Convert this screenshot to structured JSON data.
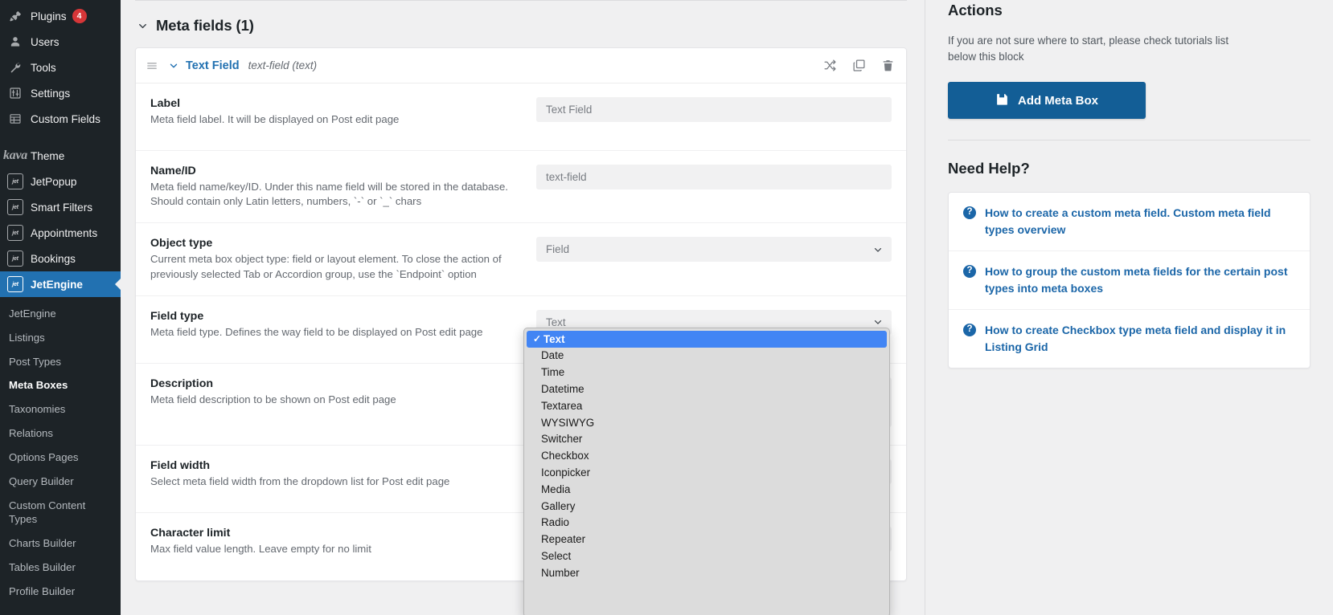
{
  "sidebar": {
    "top_items": [
      {
        "label": "Plugins",
        "icon": "plug-icon",
        "badge": "4",
        "active": false
      },
      {
        "label": "Users",
        "icon": "user-icon",
        "badge": "",
        "active": false
      },
      {
        "label": "Tools",
        "icon": "wrench-icon",
        "badge": "",
        "active": false
      },
      {
        "label": "Settings",
        "icon": "sliders-icon",
        "badge": "",
        "active": false
      },
      {
        "label": "Custom Fields",
        "icon": "table-icon",
        "badge": "",
        "active": false
      }
    ],
    "theme_item": {
      "label": "Theme",
      "logo_text": "kava"
    },
    "jet_items": [
      {
        "label": "JetPopup",
        "icon": "jet-icon",
        "active": false
      },
      {
        "label": "Smart Filters",
        "icon": "jet-icon",
        "active": false
      },
      {
        "label": "Appointments",
        "icon": "jet-icon",
        "active": false
      },
      {
        "label": "Bookings",
        "icon": "jet-icon",
        "active": false
      },
      {
        "label": "JetEngine",
        "icon": "jet-icon",
        "active": true
      }
    ],
    "submenu": [
      {
        "label": "JetEngine",
        "current": false
      },
      {
        "label": "Listings",
        "current": false
      },
      {
        "label": "Post Types",
        "current": false
      },
      {
        "label": "Meta Boxes",
        "current": true
      },
      {
        "label": "Taxonomies",
        "current": false
      },
      {
        "label": "Relations",
        "current": false
      },
      {
        "label": "Options Pages",
        "current": false
      },
      {
        "label": "Query Builder",
        "current": false
      },
      {
        "label": "Custom Content Types",
        "current": false
      },
      {
        "label": "Charts Builder",
        "current": false
      },
      {
        "label": "Tables Builder",
        "current": false
      },
      {
        "label": "Profile Builder",
        "current": false
      }
    ],
    "icon_label": "jet"
  },
  "main": {
    "section_title": "Meta fields (1)",
    "card": {
      "title": "Text Field",
      "subtitle": "text-field (text)",
      "icons": [
        "shuffle-icon",
        "copy-icon",
        "trash-icon"
      ]
    },
    "rows": [
      {
        "label": "Label",
        "desc": "Meta field label. It will be displayed on Post edit page",
        "control": "text",
        "value": "Text Field"
      },
      {
        "label": "Name/ID",
        "desc": "Meta field name/key/ID. Under this name field will be stored in the database. Should contain only Latin letters, numbers, `-` or `_` chars",
        "control": "text",
        "value": "text-field"
      },
      {
        "label": "Object type",
        "desc": "Current meta box object type: field or layout element. To close the action of previously selected Tab or Accordion group, use the `Endpoint` option",
        "control": "select",
        "value": "Field"
      },
      {
        "label": "Field type",
        "desc": "Meta field type. Defines the way field to be displayed on Post edit page",
        "control": "select",
        "value": "Text"
      },
      {
        "label": "Description",
        "desc": "Meta field description to be shown on Post edit page",
        "control": "textarea",
        "value": ""
      },
      {
        "label": "Field width",
        "desc": "Select meta field width from the dropdown list for Post edit page",
        "control": "select",
        "value": ""
      },
      {
        "label": "Character limit",
        "desc": "Max field value length. Leave empty for no limit",
        "control": "text",
        "value": ""
      }
    ]
  },
  "select_popup": {
    "open": true,
    "options": [
      "Text",
      "Date",
      "Time",
      "Datetime",
      "Textarea",
      "WYSIWYG",
      "Switcher",
      "Checkbox",
      "Iconpicker",
      "Media",
      "Gallery",
      "Radio",
      "Repeater",
      "Select",
      "Number"
    ],
    "selected": "Text",
    "checkmark": "✓"
  },
  "right": {
    "actions_title": "Actions",
    "actions_text": "If you are not sure where to start, please check tutorials list below this block",
    "add_button": "Add Meta Box",
    "add_button_icon": "save-icon",
    "help_title": "Need Help?",
    "help_items": [
      {
        "text": "How to create a custom meta field. Custom meta field types overview",
        "icon": "question-icon"
      },
      {
        "text": "How to group the custom meta fields for the certain post types into meta boxes",
        "icon": "question-icon"
      },
      {
        "text": "How to create Checkbox type meta field and display it in Listing Grid",
        "icon": "question-icon"
      }
    ]
  },
  "colors": {
    "sidebar_bg": "#1d2327",
    "active_blue": "#2271b1",
    "button_blue": "#135e96",
    "highlight_blue": "#4285f4",
    "badge_red": "#d63638",
    "link_blue": "#1b66a8"
  }
}
